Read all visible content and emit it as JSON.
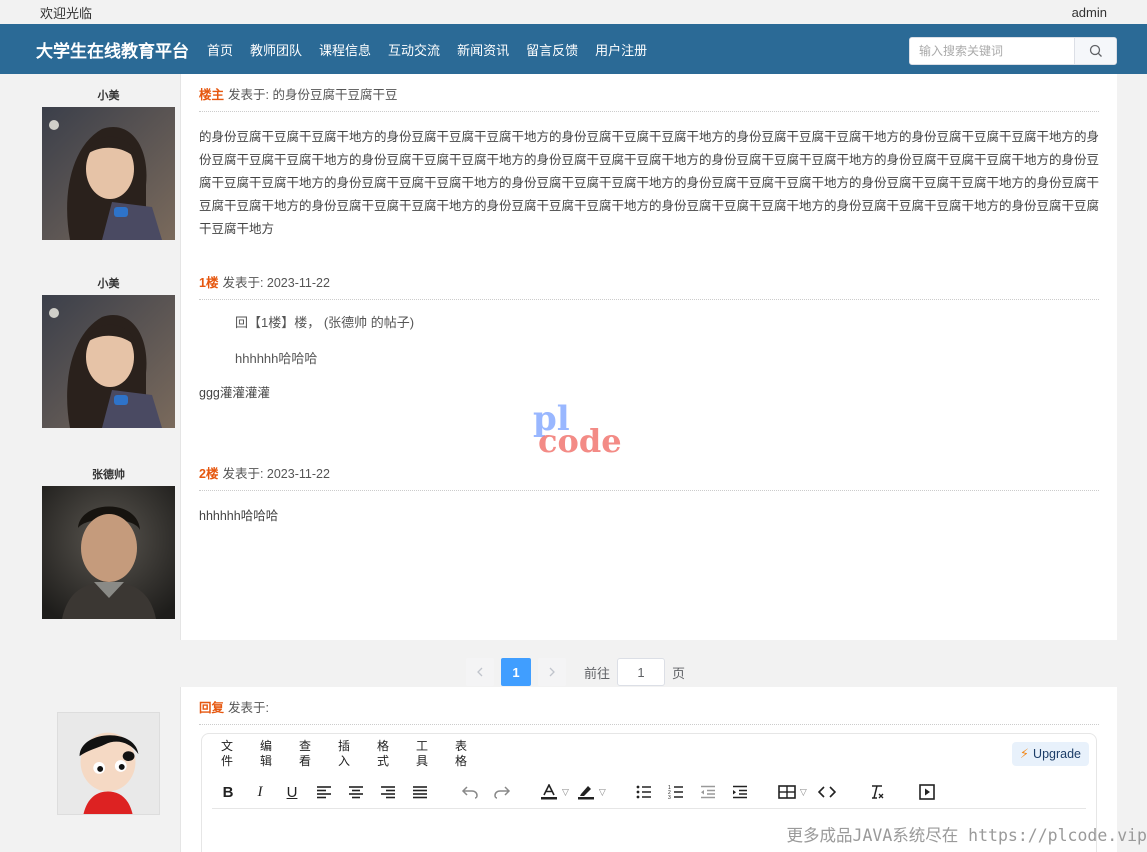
{
  "topbar": {
    "welcome": "欢迎光临",
    "user": "admin"
  },
  "nav": {
    "brand": "大学生在线教育平台",
    "links": [
      "首页",
      "教师团队",
      "课程信息",
      "互动交流",
      "新闻资讯",
      "留言反馈",
      "用户注册"
    ],
    "search_placeholder": "输入搜索关键词"
  },
  "posts": [
    {
      "author": "小美",
      "floor": "楼主",
      "posted_label": "发表于: 的身份豆腐干豆腐干豆",
      "body": "的身份豆腐干豆腐干豆腐干地方的身份豆腐干豆腐干豆腐干地方的身份豆腐干豆腐干豆腐干地方的身份豆腐干豆腐干豆腐干地方的身份豆腐干豆腐干豆腐干地方的身份豆腐干豆腐干豆腐干地方的身份豆腐干豆腐干豆腐干地方的身份豆腐干豆腐干豆腐干地方的身份豆腐干豆腐干豆腐干地方的身份豆腐干豆腐干豆腐干地方的身份豆腐干豆腐干豆腐干地方的身份豆腐干豆腐干豆腐干地方的身份豆腐干豆腐干豆腐干地方的身份豆腐干豆腐干豆腐干地方的身份豆腐干豆腐干豆腐干地方的身份豆腐干豆腐干豆腐干地方的身份豆腐干豆腐干豆腐干地方的身份豆腐干豆腐干豆腐干地方的身份豆腐干豆腐干豆腐干地方的身份豆腐干豆腐干豆腐干地方的身份豆腐干豆腐干豆腐干地方"
    },
    {
      "author": "小美",
      "floor": "1楼",
      "posted_label": "发表于: 2023-11-22",
      "quote_ref": "回【1楼】楼， (张德帅 的帖子)",
      "quote_text": "hhhhhh哈哈哈",
      "body": "ggg灌灌灌灌"
    },
    {
      "author": "张德帅",
      "floor": "2楼",
      "posted_label": "发表于: 2023-11-22",
      "body": "hhhhhh哈哈哈"
    }
  ],
  "pagination": {
    "prev_icon": "chevron-left-icon",
    "current_page": "1",
    "next_icon": "chevron-right-icon",
    "goto_prefix": "前往",
    "goto_value": "1",
    "goto_suffix": "页"
  },
  "reply": {
    "floor": "回复",
    "posted_label": "发表于:",
    "editor": {
      "menu": [
        "文件",
        "编辑",
        "查看",
        "插入",
        "格式",
        "工具",
        "表格"
      ],
      "upgrade_label": "Upgrade",
      "toolbar_icons": [
        "bold-icon",
        "italic-icon",
        "underline-icon",
        "align-left-icon",
        "align-center-icon",
        "align-right-icon",
        "align-justify-icon",
        "undo-icon",
        "redo-icon",
        "text-color-icon",
        "highlight-color-icon",
        "bullet-list-icon",
        "numbered-list-icon",
        "outdent-icon",
        "indent-icon",
        "table-icon",
        "code-icon",
        "clear-format-icon",
        "media-icon"
      ]
    }
  },
  "watermark": {
    "line1": "pl",
    "line2": "code"
  },
  "footer_note": "更多成品JAVA系统尽在 https://plcode.vip",
  "colors": {
    "nav_bg": "#2b6a96",
    "floor_label": "#e6570f",
    "page_active": "#409eff"
  }
}
